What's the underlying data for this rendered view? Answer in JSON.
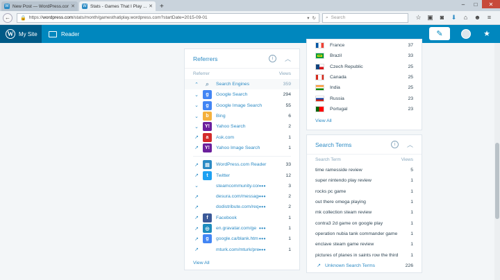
{
  "browser": {
    "tabs": [
      {
        "title": "New Post — WordPress.com",
        "fav": "W",
        "active": false
      },
      {
        "title": "Stats - Games That I Play ...",
        "fav": "W",
        "active": true
      }
    ],
    "url_prefix": "https://",
    "url_host": "wordpress.com",
    "url_rest": "/stats/month/gamesthatiplay.wordpress.com?startDate=2015-09-01",
    "search_placeholder": "Search"
  },
  "masterbar": {
    "my_site": "My Site",
    "reader": "Reader"
  },
  "referrers": {
    "title": "Referrers",
    "col_left": "Referrer",
    "col_right": "Views",
    "rows": [
      {
        "label": "Search Engines",
        "value": "359",
        "expand": "^",
        "icon": "search-icon",
        "color": "",
        "kind": "engines"
      },
      {
        "label": "Google Search",
        "value": "294",
        "expand": "v",
        "icon": "google-icon",
        "color": "#4285f4",
        "kind": "normal",
        "glyph": "g"
      },
      {
        "label": "Google Image Search",
        "value": "55",
        "expand": "v",
        "icon": "google-icon",
        "color": "#4285f4",
        "kind": "normal",
        "glyph": "g"
      },
      {
        "label": "Bing",
        "value": "6",
        "expand": "v",
        "icon": "bing-icon",
        "color": "#f4b03c",
        "kind": "normal",
        "glyph": "b"
      },
      {
        "label": "Yahoo Search",
        "value": "2",
        "expand": "v",
        "icon": "yahoo-icon",
        "color": "#6b1f9c",
        "kind": "normal",
        "glyph": "Y!"
      },
      {
        "label": "Ask.com",
        "value": "1",
        "expand": "↗",
        "icon": "ask-icon",
        "color": "#d32b2b",
        "kind": "normal",
        "glyph": "a"
      },
      {
        "label": "Yahoo Image Search",
        "value": "1",
        "expand": "↗",
        "icon": "yahoo-icon",
        "color": "#6b1f9c",
        "kind": "normal",
        "glyph": "Y!"
      },
      {
        "label": "WordPress.com Reader",
        "value": "33",
        "expand": "↗",
        "icon": "reader-icon",
        "color": "#2b8ac4",
        "kind": "normal",
        "glyph": "▤",
        "gap": true
      },
      {
        "label": "Twitter",
        "value": "12",
        "expand": "↗",
        "icon": "twitter-icon",
        "color": "#1da1f2",
        "kind": "normal",
        "glyph": "t"
      },
      {
        "label": "steamcommunity.com",
        "value": "3",
        "expand": "v",
        "icon": "",
        "color": "",
        "kind": "dots"
      },
      {
        "label": "desura.com/messages/m",
        "value": "2",
        "expand": "↗",
        "icon": "",
        "color": "",
        "kind": "dots"
      },
      {
        "label": "dodistribute.com/request",
        "value": "2",
        "expand": "↗",
        "icon": "",
        "color": "",
        "kind": "dots"
      },
      {
        "label": "Facebook",
        "value": "1",
        "expand": "↗",
        "icon": "facebook-icon",
        "color": "#3b5998",
        "kind": "normal",
        "glyph": "f"
      },
      {
        "label": "en.gravatar.com/ge",
        "value": "1",
        "expand": "↗",
        "icon": "gravatar-icon",
        "color": "#1e8cbe",
        "kind": "dots",
        "glyph": "◎"
      },
      {
        "label": "google.ca/blank.htm",
        "value": "1",
        "expand": "↗",
        "icon": "google-icon",
        "color": "#4285f4",
        "kind": "dots",
        "glyph": "g"
      },
      {
        "label": "mturk.com/mturk/previe",
        "value": "1",
        "expand": "↗",
        "icon": "",
        "color": "",
        "kind": "dots"
      }
    ],
    "view_all": "View All"
  },
  "countries": {
    "rows": [
      {
        "label": "France",
        "value": "37",
        "flag": "france-flag"
      },
      {
        "label": "Brazil",
        "value": "33",
        "flag": "brazil-flag"
      },
      {
        "label": "Czech Republic",
        "value": "25",
        "flag": "czech-flag"
      },
      {
        "label": "Canada",
        "value": "25",
        "flag": "canada-flag"
      },
      {
        "label": "India",
        "value": "25",
        "flag": "india-flag"
      },
      {
        "label": "Russia",
        "value": "23",
        "flag": "russia-flag"
      },
      {
        "label": "Portugal",
        "value": "23",
        "flag": "portugal-flag"
      }
    ],
    "view_all": "View All"
  },
  "search_terms": {
    "title": "Search Terms",
    "col_left": "Search Term",
    "col_right": "Views",
    "rows": [
      {
        "label": "time ramesside review",
        "value": "5"
      },
      {
        "label": "super nintendo play review",
        "value": "1"
      },
      {
        "label": "rocks pc game",
        "value": "1"
      },
      {
        "label": "out there omega playing",
        "value": "1"
      },
      {
        "label": "mk collection steam review",
        "value": "1"
      },
      {
        "label": "contra3 2d game on google play",
        "value": "1"
      },
      {
        "label": "operation nubia tank commander game",
        "value": "1"
      },
      {
        "label": "enclave steam game review",
        "value": "1"
      },
      {
        "label": "pictures of planes in saints row the third",
        "value": "1"
      }
    ],
    "unknown_label": "Unknown Search Terms",
    "unknown_value": "226"
  }
}
